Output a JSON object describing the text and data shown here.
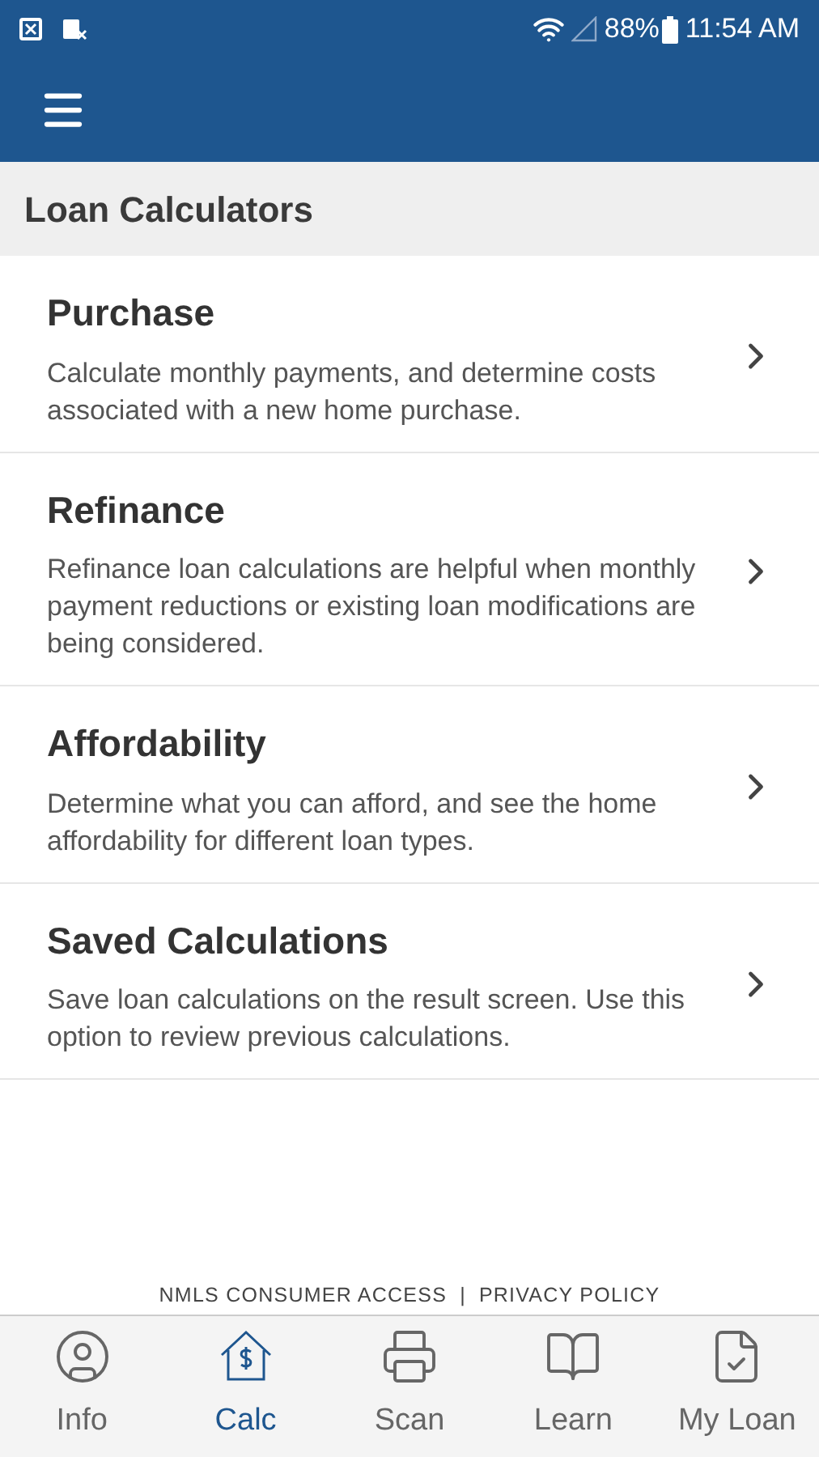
{
  "status_bar": {
    "battery": "88%",
    "time": "11:54 AM"
  },
  "section_title": "Loan Calculators",
  "items": [
    {
      "title": "Purchase",
      "description": "Calculate monthly payments, and determine costs associated with a new home purchase."
    },
    {
      "title": "Refinance",
      "description": "Refinance loan calculations are helpful when monthly payment reductions or existing loan modifications are being considered."
    },
    {
      "title": "Affordability",
      "description": "Determine what you can afford, and see the home affordability for different loan types."
    },
    {
      "title": "Saved Calculations",
      "description": "Save loan calculations on the result screen. Use this option to review previous calculations."
    }
  ],
  "footer_links": [
    "NMLS CONSUMER ACCESS",
    "|",
    "PRIVACY POLICY"
  ],
  "tabs": [
    {
      "label": "Info",
      "kind": "info",
      "selected": false
    },
    {
      "label": "Calc",
      "kind": "calc",
      "selected": true
    },
    {
      "label": "Scan",
      "kind": "scan",
      "selected": false
    },
    {
      "label": "Learn",
      "kind": "learn",
      "selected": false
    },
    {
      "label": "My Loan",
      "kind": "loan",
      "selected": false
    }
  ]
}
